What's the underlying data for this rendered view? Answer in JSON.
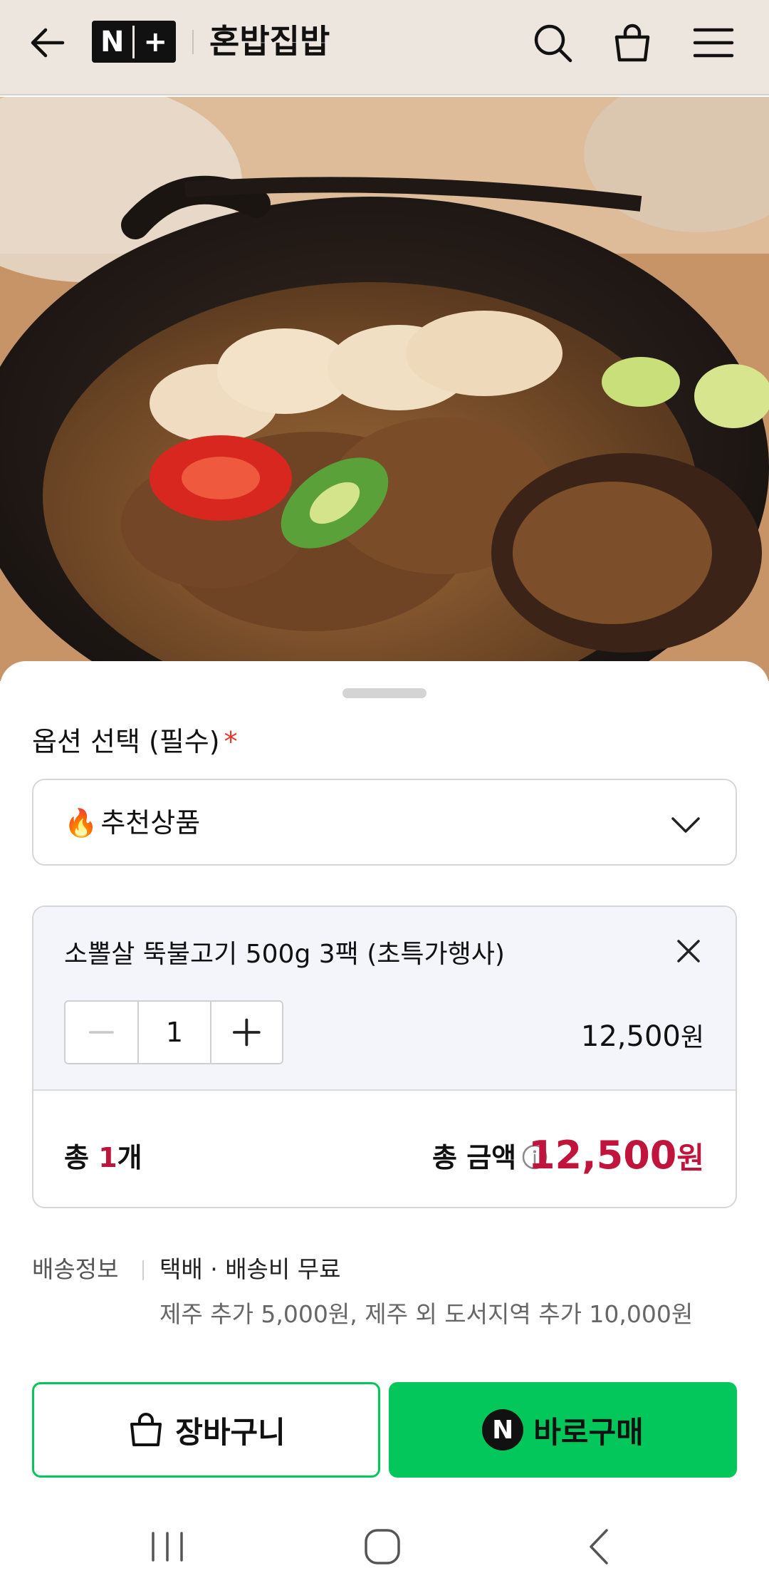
{
  "header": {
    "logo_text": "N+",
    "store_name": "혼밥집밥",
    "icons": [
      "back-arrow-icon",
      "search-icon",
      "shopping-bag-icon",
      "menu-icon"
    ]
  },
  "options": {
    "label": "옵션 선택 (필수)",
    "required_mark": "*",
    "selected_icon": "🔥",
    "selected_value": "추천상품"
  },
  "cart_item": {
    "name": "소뽈살 뚝불고기 500g 3팩 (초특가행사)",
    "quantity": "1",
    "price": "12,500",
    "currency": "원"
  },
  "summary": {
    "count_prefix": "총 ",
    "count_value": "1",
    "count_suffix": "개",
    "amount_label": "총 금액",
    "amount_value": "12,500",
    "currency": "원"
  },
  "shipping": {
    "label": "배송정보",
    "method": "택배 · 배송비 무료",
    "extra": "제주 추가 5,000원, 제주 외 도서지역 추가 10,000원"
  },
  "buttons": {
    "cart_label": "장바구니",
    "buy_badge": "N",
    "buy_label": "바로구매"
  },
  "colors": {
    "header_bg": "#ede6df",
    "accent_green": "#03c75a",
    "price_red": "#c0143c",
    "required_red": "#e8332a"
  }
}
